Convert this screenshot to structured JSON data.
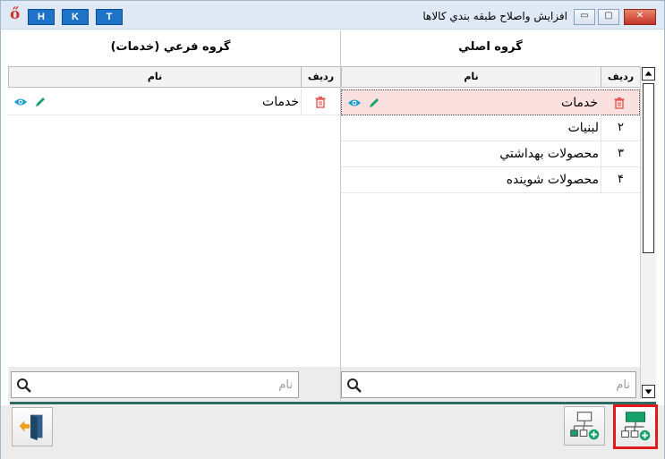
{
  "window": {
    "title": "افزايش واصلاح طبقه بندي كالاها",
    "hkt": [
      "H",
      "K",
      "T"
    ],
    "logo_glyph": "ő",
    "controls": {
      "minimize": "▭",
      "restore": "▢",
      "close": "✕"
    }
  },
  "main_group": {
    "title": "گروه اصلي",
    "columns": {
      "row": "رديف",
      "name": "نام"
    },
    "rows": [
      {
        "num": "",
        "name": "خدمات",
        "selected": true
      },
      {
        "num": "٢",
        "name": "لبنيات"
      },
      {
        "num": "٣",
        "name": "محصولات بهداشتي"
      },
      {
        "num": "۴",
        "name": "محصولات شوينده"
      }
    ],
    "search_placeholder": "نام"
  },
  "sub_group": {
    "title": "گروه فرعي (خدمات)",
    "columns": {
      "row": "رديف",
      "name": "نام"
    },
    "rows": [
      {
        "num": "",
        "name": "خدمات"
      }
    ],
    "search_placeholder": "نام"
  },
  "colors": {
    "accent": "#2e6a63",
    "highlight_border": "#e11b1b",
    "selected_row": "#fbe0e0",
    "icon_green": "#16a06a",
    "icon_blue": "#1e73c8",
    "trash_red": "#e0504a"
  },
  "icons": {
    "trash": "trash-icon",
    "edit": "pencil-icon",
    "view": "eye-icon",
    "search": "search-icon",
    "exit": "exit-door-icon",
    "add_main": "add-main-group-icon",
    "add_sub": "add-sub-group-icon"
  }
}
